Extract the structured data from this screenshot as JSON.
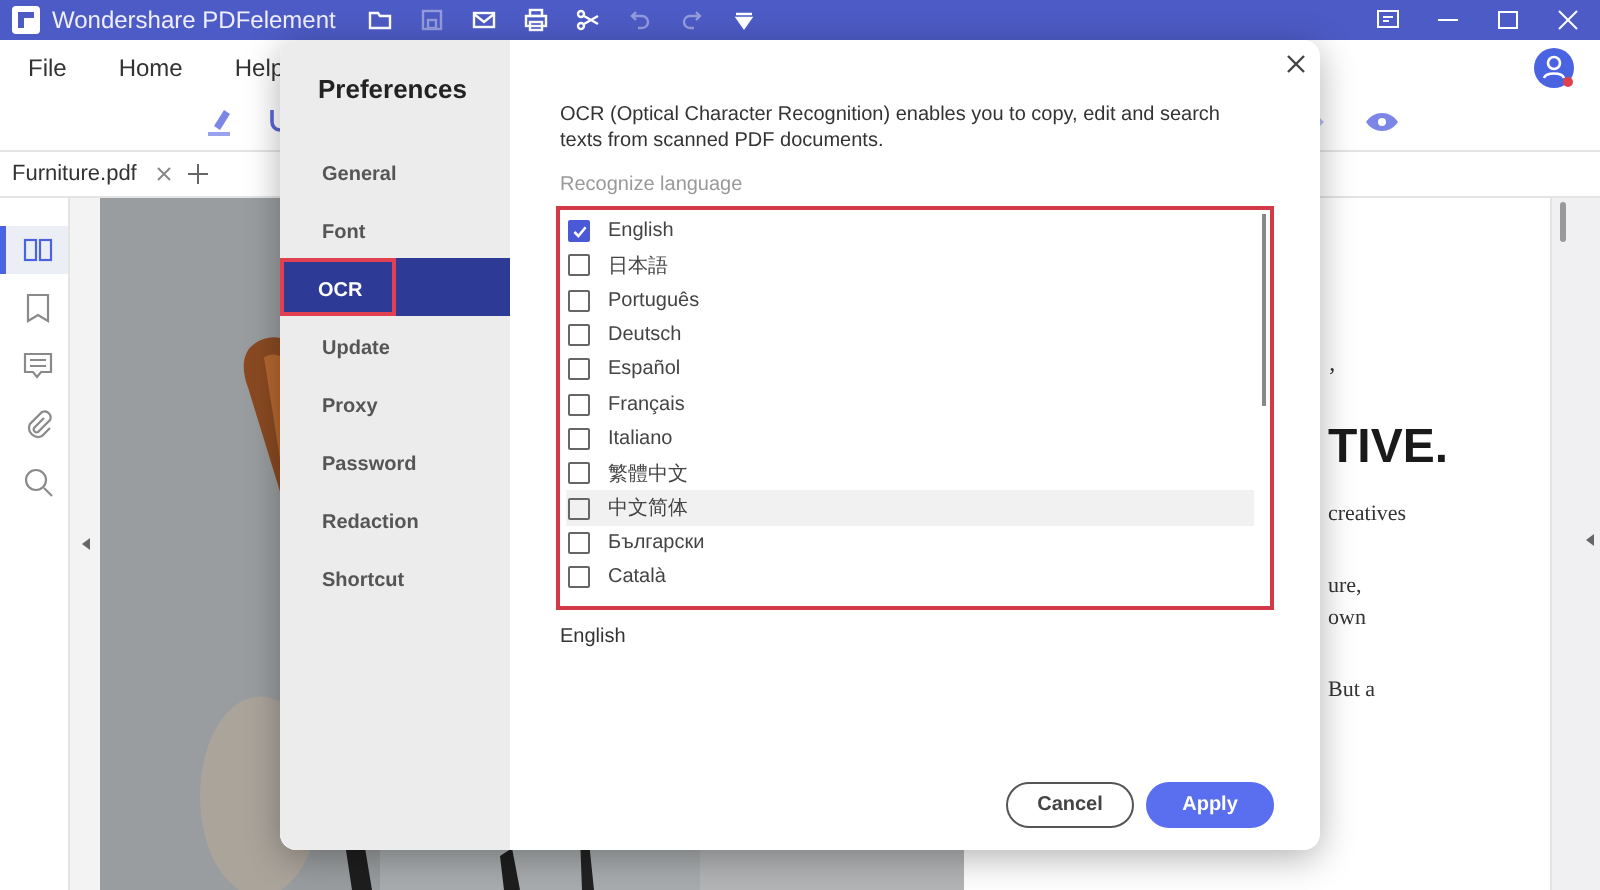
{
  "window": {
    "title": "Wondershare PDFelement"
  },
  "quick_toolbar": [
    {
      "kind": "folder",
      "disabled": false
    },
    {
      "kind": "save",
      "disabled": true
    },
    {
      "kind": "mail",
      "disabled": false
    },
    {
      "kind": "print",
      "disabled": false
    },
    {
      "kind": "scissors",
      "disabled": false
    },
    {
      "kind": "undo",
      "disabled": true
    },
    {
      "kind": "redo",
      "disabled": true
    },
    {
      "kind": "dropdown",
      "disabled": false
    }
  ],
  "menu": [
    {
      "label": "File"
    },
    {
      "label": "Home"
    },
    {
      "label": "Help"
    }
  ],
  "tool_icons_left": [
    {
      "kind": "highlighter"
    },
    {
      "kind": "underline"
    }
  ],
  "tool_icons_right": [
    {
      "kind": "diamond"
    },
    {
      "kind": "eye"
    }
  ],
  "tabs": [
    {
      "label": "Furniture.pdf",
      "selected": true
    }
  ],
  "sidebar": {
    "items": [
      {
        "kind": "thumbnails",
        "selected": true
      },
      {
        "kind": "bookmark",
        "selected": false
      },
      {
        "kind": "comment",
        "selected": false
      },
      {
        "kind": "attachment",
        "selected": false
      },
      {
        "kind": "search",
        "selected": false
      }
    ]
  },
  "document": {
    "texts": [
      {
        "kind": "mark",
        "text": "’"
      },
      {
        "kind": "heading",
        "text": "TIVE."
      },
      {
        "kind": "body",
        "text": "creatives"
      },
      {
        "kind": "gap",
        "text": "ure,"
      },
      {
        "kind": "body",
        "text": "own"
      },
      {
        "kind": "gap",
        "text": "But a"
      }
    ]
  },
  "dialog": {
    "title": "Preferences",
    "nav": [
      {
        "label": "General",
        "selected": false,
        "highlighted": false
      },
      {
        "label": "Font",
        "selected": false,
        "highlighted": false
      },
      {
        "label": "OCR",
        "selected": true,
        "highlighted": true
      },
      {
        "label": "Update",
        "selected": false,
        "highlighted": false
      },
      {
        "label": "Proxy",
        "selected": false,
        "highlighted": false
      },
      {
        "label": "Password",
        "selected": false,
        "highlighted": false
      },
      {
        "label": "Redaction",
        "selected": false,
        "highlighted": false
      },
      {
        "label": "Shortcut",
        "selected": false,
        "highlighted": false
      }
    ],
    "description": "OCR (Optical Character Recognition) enables you to copy, edit and search texts from scanned PDF documents.",
    "language_label": "Recognize language",
    "list_highlighted": true,
    "languages": [
      {
        "label": "English",
        "checked": true,
        "hovered": false
      },
      {
        "label": "日本語",
        "checked": false,
        "hovered": false
      },
      {
        "label": "Português",
        "checked": false,
        "hovered": false
      },
      {
        "label": "Deutsch",
        "checked": false,
        "hovered": false
      },
      {
        "label": "Español",
        "checked": false,
        "hovered": false
      },
      {
        "label": "Français",
        "checked": false,
        "hovered": false
      },
      {
        "label": "Italiano",
        "checked": false,
        "hovered": false
      },
      {
        "label": "繁體中文",
        "checked": false,
        "hovered": false
      },
      {
        "label": "中文简体",
        "checked": false,
        "hovered": true
      },
      {
        "label": "Български",
        "checked": false,
        "hovered": false
      },
      {
        "label": "Català",
        "checked": false,
        "hovered": false
      }
    ],
    "selected_summary": "English",
    "buttons": [
      {
        "label": "Cancel",
        "kind": "secondary"
      },
      {
        "label": "Apply",
        "kind": "primary"
      }
    ]
  }
}
